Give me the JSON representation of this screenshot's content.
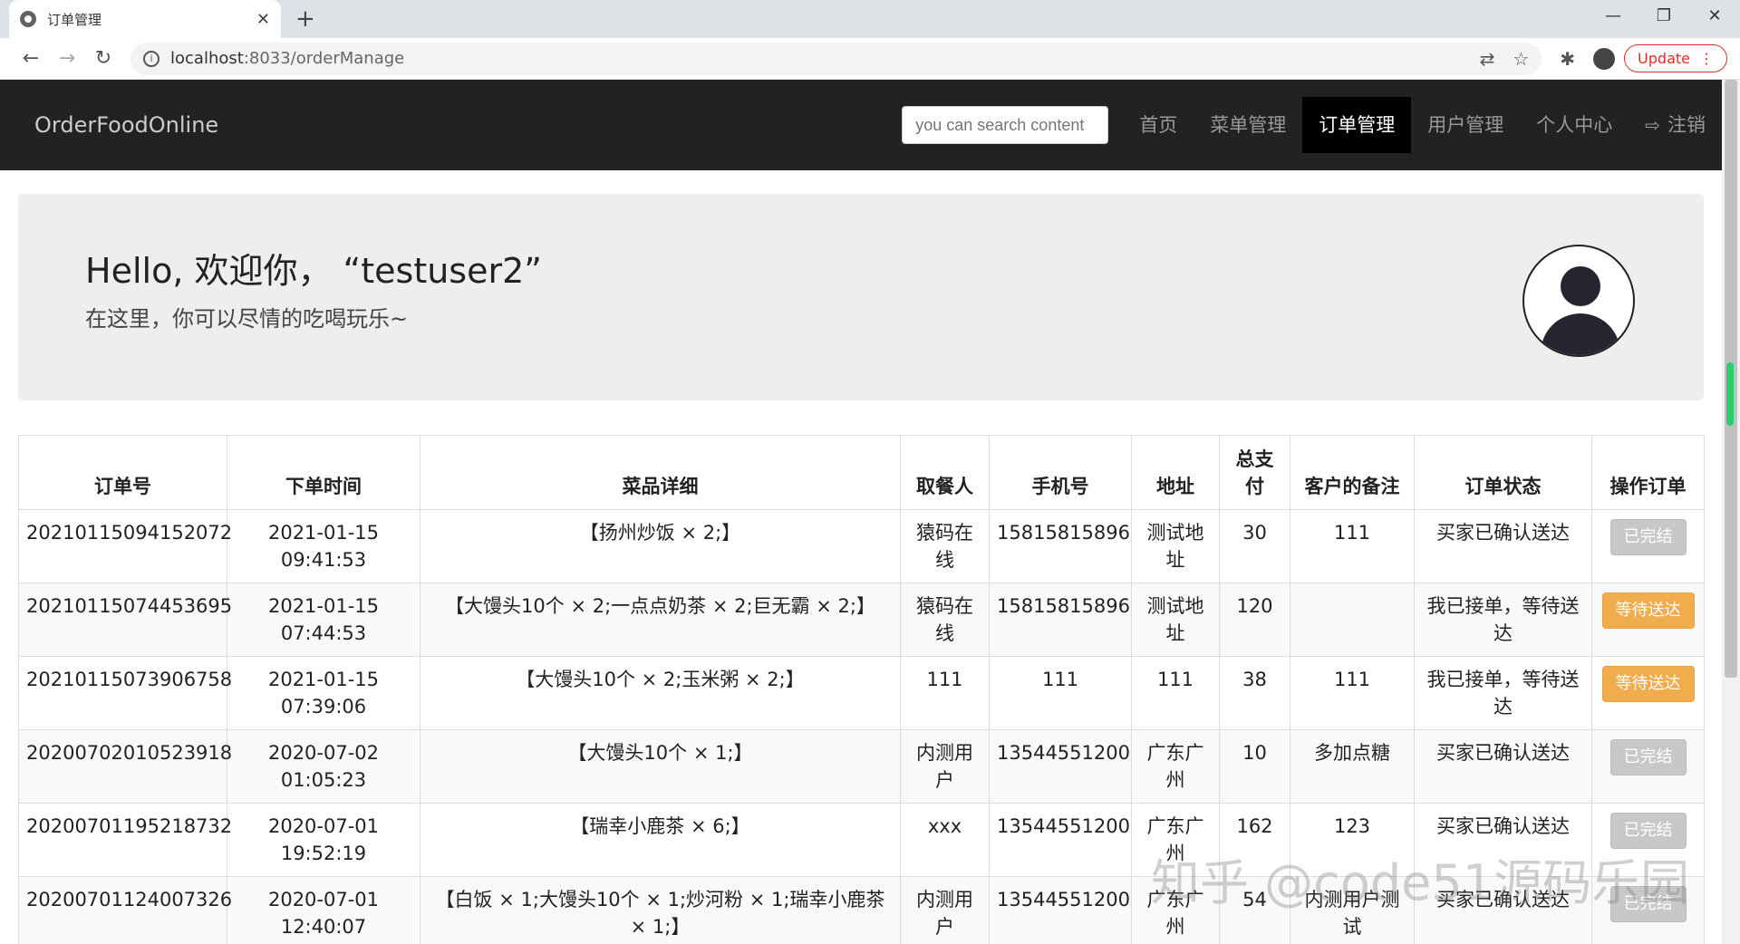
{
  "browser": {
    "tab_title": "订单管理",
    "url_host": "localhost",
    "url_path": ":8033/orderManage",
    "update_label": "Update"
  },
  "nav": {
    "brand": "OrderFoodOnline",
    "search_placeholder": "you can search content",
    "links": [
      "首页",
      "菜单管理",
      "订单管理",
      "用户管理",
      "个人中心",
      "注销"
    ]
  },
  "jumbo": {
    "greeting": "Hello, 欢迎你， “testuser2”",
    "subtitle": "在这里，你可以尽情的吃喝玩乐~"
  },
  "table": {
    "headers": [
      "订单号",
      "下单时间",
      "菜品详细",
      "取餐人",
      "手机号",
      "地址",
      "总支付",
      "客户的备注",
      "订单状态",
      "操作订单"
    ],
    "rows": [
      {
        "id": "20210115094152072",
        "time": "2021-01-15 09:41:53",
        "detail": "【扬州炒饭 × 2;】",
        "name": "猿码在线",
        "phone": "15815815896",
        "addr": "测试地址",
        "total": "30",
        "note": "111",
        "status": "买家已确认送达",
        "action": "已完结",
        "action_type": "done"
      },
      {
        "id": "20210115074453695",
        "time": "2021-01-15 07:44:53",
        "detail": "【大馒头10个 × 2;一点点奶茶 × 2;巨无霸 × 2;】",
        "name": "猿码在线",
        "phone": "15815815896",
        "addr": "测试地址",
        "total": "120",
        "note": "",
        "status": "我已接单，等待送达",
        "action": "等待送达",
        "action_type": "wait"
      },
      {
        "id": "20210115073906758",
        "time": "2021-01-15 07:39:06",
        "detail": "【大馒头10个 × 2;玉米粥 × 2;】",
        "name": "111",
        "phone": "111",
        "addr": "111",
        "total": "38",
        "note": "111",
        "status": "我已接单，等待送达",
        "action": "等待送达",
        "action_type": "wait"
      },
      {
        "id": "20200702010523918",
        "time": "2020-07-02 01:05:23",
        "detail": "【大馒头10个 × 1;】",
        "name": "内测用户",
        "phone": "13544551200",
        "addr": "广东广州",
        "total": "10",
        "note": "多加点糖",
        "status": "买家已确认送达",
        "action": "已完结",
        "action_type": "done"
      },
      {
        "id": "20200701195218732",
        "time": "2020-07-01 19:52:19",
        "detail": "【瑞幸小鹿茶 × 6;】",
        "name": "xxx",
        "phone": "13544551200",
        "addr": "广东广州",
        "total": "162",
        "note": "123",
        "status": "买家已确认送达",
        "action": "已完结",
        "action_type": "done"
      },
      {
        "id": "20200701124007326",
        "time": "2020-07-01 12:40:07",
        "detail": "【白饭 × 1;大馒头10个 × 1;炒河粉 × 1;瑞幸小鹿茶 × 1;】",
        "name": "内测用户",
        "phone": "13544551200",
        "addr": "广东广州",
        "total": "54",
        "note": "内测用户测试",
        "status": "买家已确认送达",
        "action": "已完结",
        "action_type": "done"
      }
    ]
  },
  "watermark": "知乎 @code51源码乐园"
}
